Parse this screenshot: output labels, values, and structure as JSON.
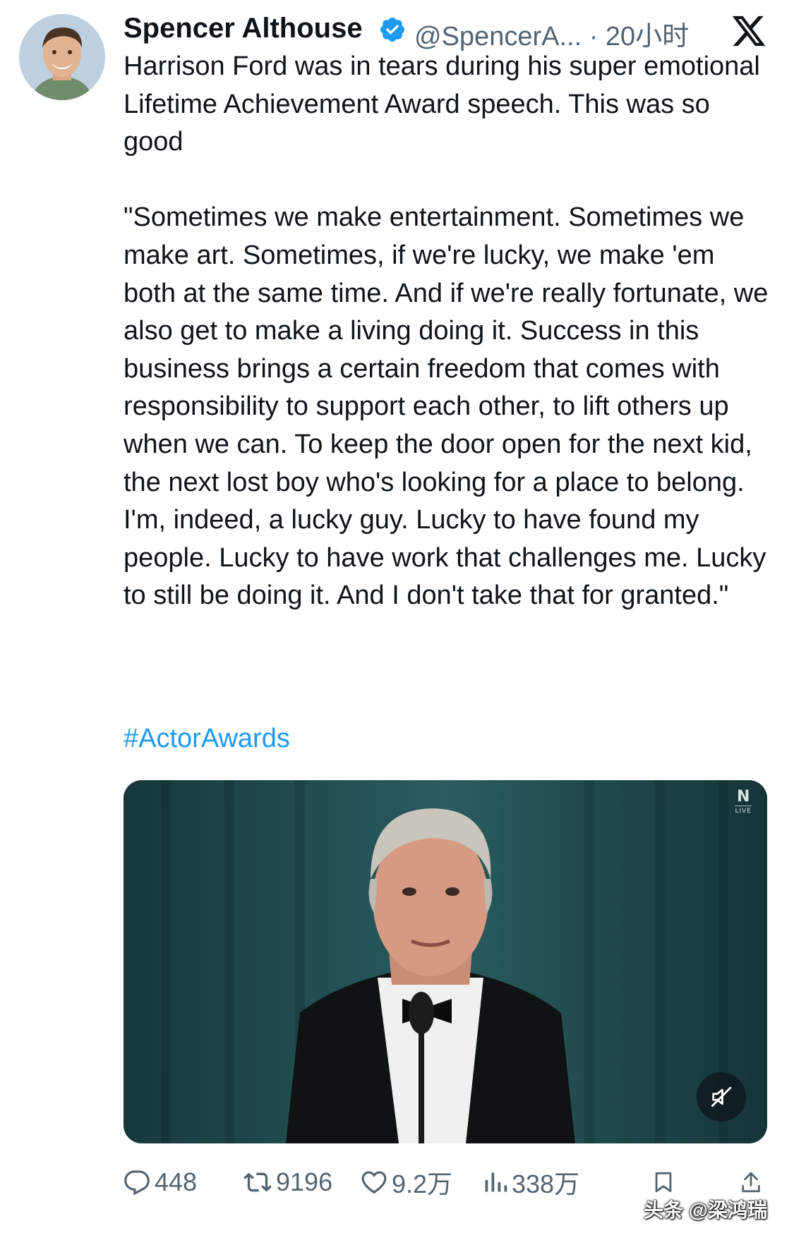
{
  "author": {
    "name": "Spencer Althouse",
    "handle": "@SpencerA...",
    "time": "· 20小时",
    "verified": true,
    "avatar_icon": "avatar-photo"
  },
  "platform_icon": "x-logo-icon",
  "tweet": {
    "paragraphs": [
      "Harrison Ford was in tears during his super emotional Lifetime Achievement Award speech. This was so good",
      "\"Sometimes we make entertainment. Sometimes we make art. Sometimes, if we're lucky, we make 'em both at the same time. And if we're really fortunate, we also get to make a living doing it. Success in this business brings a certain freedom that comes with responsibility to support each other, to lift others up when we can. To keep the door open for the next kid, the next lost boy who's looking for a place to belong. I'm, indeed, a lucky guy. Lucky to have found my people. Lucky to have work that challenges me. Lucky to still be doing it. And I don't take that for granted.\""
    ],
    "hashtag": "#ActorAwards"
  },
  "media": {
    "type": "video",
    "badge_letter": "N",
    "badge_text": "LIVE",
    "muted": true
  },
  "actions": {
    "replies": "448",
    "reposts": "9196",
    "likes": "9.2万",
    "views": "338万"
  },
  "watermark": "头条 @梁鸿瑞",
  "colors": {
    "text": "#0f1419",
    "secondary": "#536471",
    "link": "#1d9bf0",
    "verified": "#1d9bf0"
  }
}
